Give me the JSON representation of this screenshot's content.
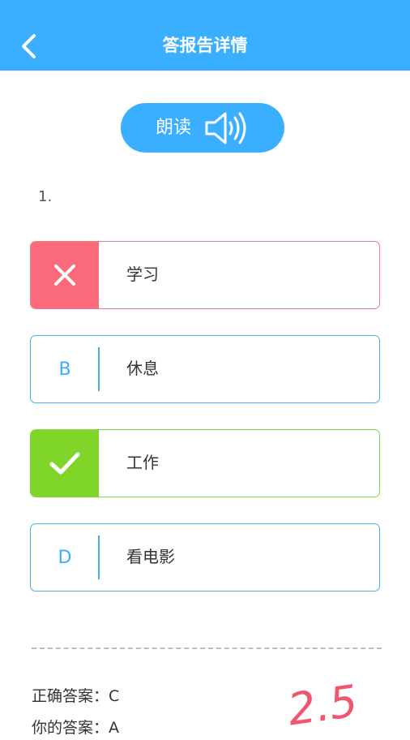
{
  "header": {
    "title": "答报告详情",
    "back_icon": "chevron-left-icon"
  },
  "read_button": {
    "label": "朗读",
    "icon": "speaker-icon"
  },
  "question": {
    "number": "1."
  },
  "options": [
    {
      "badge": "✕",
      "text": "学习",
      "state": "wrong"
    },
    {
      "badge": "B",
      "text": "休息",
      "state": "normal"
    },
    {
      "badge": "✓",
      "text": "工作",
      "state": "correct"
    },
    {
      "badge": "D",
      "text": "看电影",
      "state": "normal"
    }
  ],
  "answers": {
    "correct_label": "正确答案：C",
    "yours_label": "你的答案：A"
  },
  "score": "2.5",
  "colors": {
    "primary": "#3aaeff",
    "wrong": "#fb6b7b",
    "correct": "#7fd629",
    "score": "#f0566e"
  }
}
